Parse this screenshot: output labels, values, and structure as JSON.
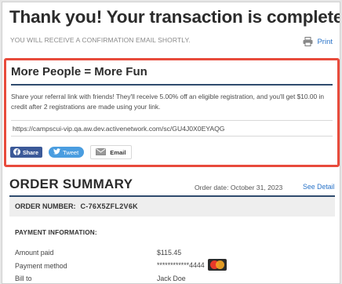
{
  "header": {
    "title": "Thank you! Your transaction is complete.",
    "subtitle": "YOU WILL RECEIVE A CONFIRMATION EMAIL SHORTLY.",
    "print_label": "Print",
    "print_icon": "printer-icon"
  },
  "referral": {
    "title": "More People = More Fun",
    "description": "Share your referral link with friends! They'll receive 5.00% off an eligible registration, and you'll get $10.00 in credit after 2 registrations are made using your link.",
    "link": "https://campscui-vip.qa.aw.dev.activenetwork.com/sc/GU4J0X0EYAQG",
    "share_buttons": {
      "facebook": "Share",
      "twitter": "Tweet",
      "email": "Email"
    },
    "border_color": "#e84b3c"
  },
  "summary": {
    "title": "ORDER SUMMARY",
    "order_date": "Order date: October 31, 2023",
    "see_detail": "See Detail",
    "order_number_label": "ORDER NUMBER:",
    "order_number": "C-76X5ZFL2V6K"
  },
  "payment": {
    "heading": "PAYMENT INFORMATION:",
    "rows": [
      {
        "label": "Amount paid",
        "value": "$115.45"
      },
      {
        "label": "Payment method",
        "value": "************4444",
        "icon": "mastercard-icon"
      },
      {
        "label": "Bill to",
        "value": "Jack Doe"
      }
    ]
  },
  "colors": {
    "link_blue": "#2a74c9",
    "accent_navy": "#2f4b6e",
    "facebook_blue": "#3b5998",
    "twitter_blue": "#4a9de0"
  }
}
